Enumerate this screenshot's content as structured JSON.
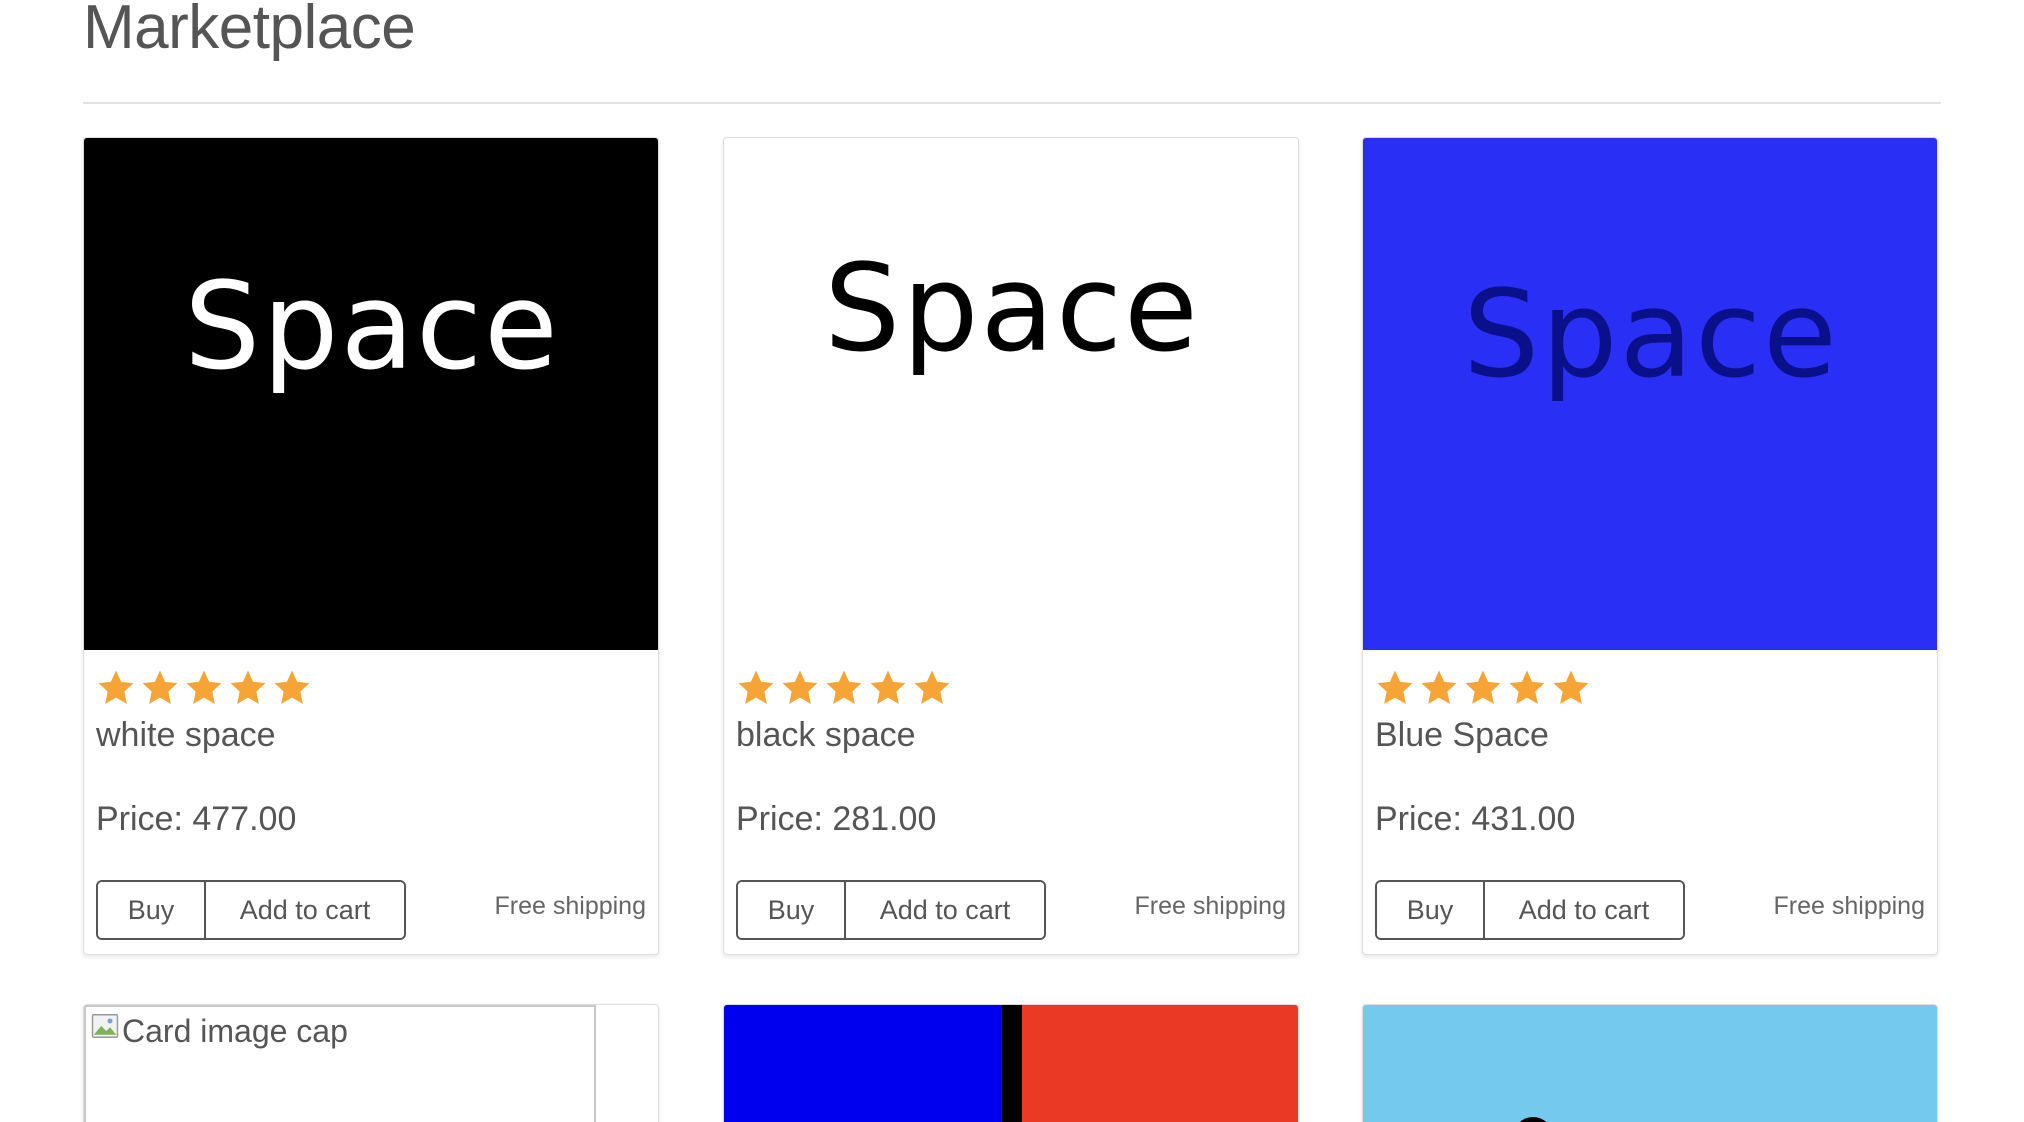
{
  "page": {
    "title": "Marketplace"
  },
  "colors": {
    "star": "#f5a435",
    "text": "#555555",
    "border": "#dddddd"
  },
  "products": [
    {
      "image_text": "Space",
      "image_bg": "#000000",
      "rating": 5,
      "rating_max": 5,
      "name": "white space",
      "price": "Price: 477.00",
      "buy_label": "Buy",
      "cart_label": "Add to cart",
      "shipping": "Free shipping"
    },
    {
      "image_text": "Space",
      "image_bg": "#ffffff",
      "rating": 5,
      "rating_max": 5,
      "name": "black space",
      "price": "Price: 281.00",
      "buy_label": "Buy",
      "cart_label": "Add to cart",
      "shipping": "Free shipping"
    },
    {
      "image_text": "Space",
      "image_bg": "#2a2ff5",
      "rating": 5,
      "rating_max": 5,
      "name": "Blue Space",
      "price": "Price: 431.00",
      "buy_label": "Buy",
      "cart_label": "Add to cart",
      "shipping": "Free shipping"
    }
  ],
  "second_row": [
    {
      "image_alt": "Card image cap",
      "icon": "broken-image-icon"
    },
    {
      "colors": [
        "#0000ee",
        "#000000",
        "#ea3a25"
      ]
    },
    {
      "colors": [
        "#74c9ef",
        "#000000"
      ]
    }
  ]
}
